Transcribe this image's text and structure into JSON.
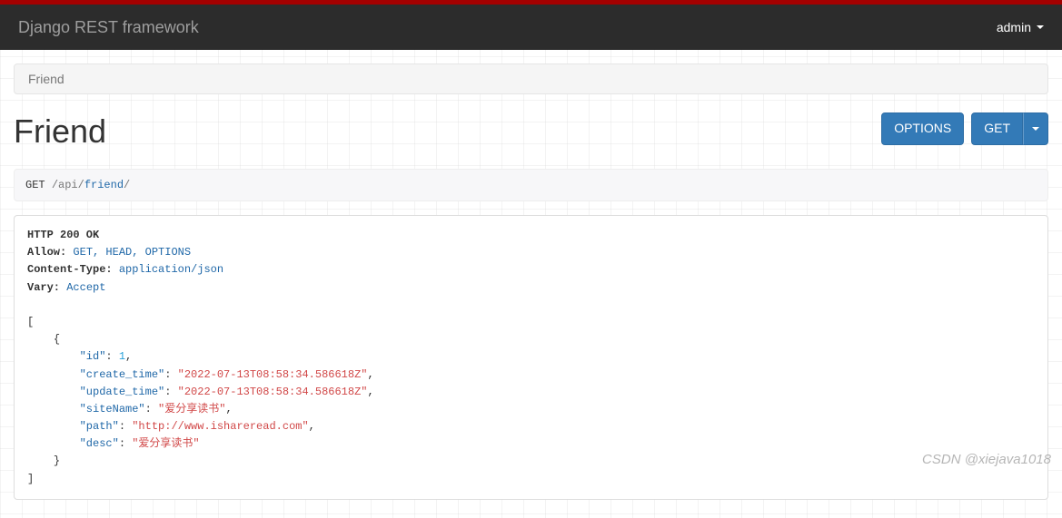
{
  "navbar": {
    "brand": "Django REST framework",
    "user": "admin"
  },
  "breadcrumb": {
    "current": "Friend"
  },
  "page": {
    "title": "Friend"
  },
  "actions": {
    "options_label": "OPTIONS",
    "get_label": "GET"
  },
  "request": {
    "method": "GET",
    "path_root": "/api/",
    "path_leaf": "friend",
    "path_trail": "/"
  },
  "response": {
    "status_line": "HTTP 200 OK",
    "headers": {
      "allow_name": "Allow:",
      "allow_value": "GET, HEAD, OPTIONS",
      "ctype_name": "Content-Type:",
      "ctype_value": "application/json",
      "vary_name": "Vary:",
      "vary_value": "Accept"
    },
    "body": [
      {
        "id": 1,
        "create_time": "2022-07-13T08:58:34.586618Z",
        "update_time": "2022-07-13T08:58:34.586618Z",
        "siteName": "爱分享读书",
        "path": "http://www.ishareread.com",
        "desc": "爱分享读书"
      }
    ],
    "keys": {
      "id": "\"id\"",
      "create_time": "\"create_time\"",
      "update_time": "\"update_time\"",
      "siteName": "\"siteName\"",
      "path": "\"path\"",
      "desc": "\"desc\""
    },
    "vals": {
      "id": "1",
      "create_time": "\"2022-07-13T08:58:34.586618Z\"",
      "update_time": "\"2022-07-13T08:58:34.586618Z\"",
      "siteName": "\"爱分享读书\"",
      "path": "\"http://www.ishareread.com\"",
      "desc": "\"爱分享读书\""
    }
  },
  "watermark": "CSDN @xiejava1018"
}
